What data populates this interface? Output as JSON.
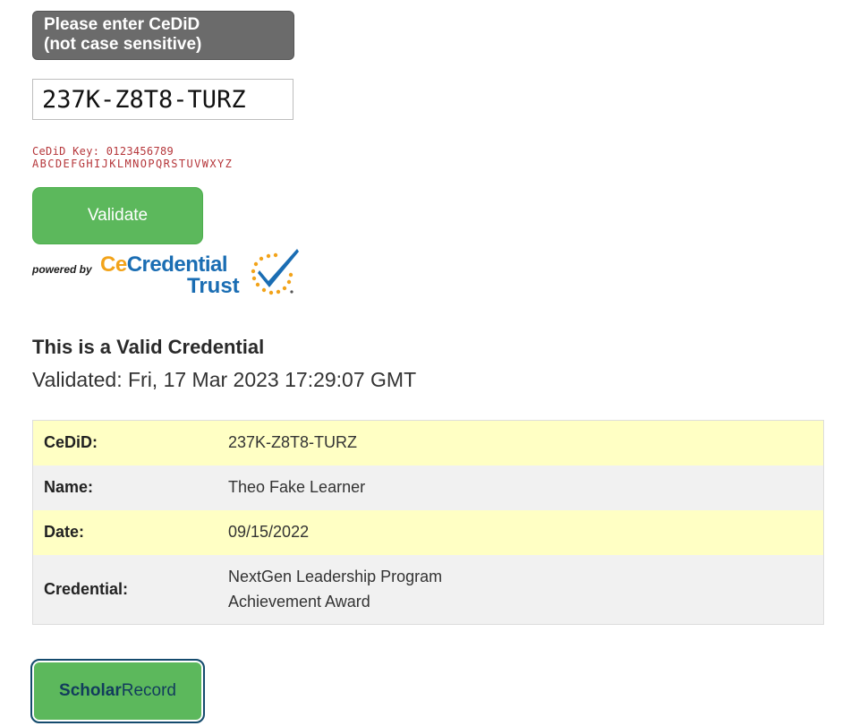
{
  "prompt": {
    "line1": "Please enter CeDiD",
    "line2": "(not case sensitive)"
  },
  "input": {
    "value": "237K-Z8T8-TURZ"
  },
  "key": {
    "line1": "CeDiD Key: 0123456789",
    "line2": "ABCDEFGHIJKLMNOPQRSTUVWXYZ"
  },
  "validate_label": "Validate",
  "branding": {
    "powered_by": "powered by",
    "brand_ce": "Ce",
    "brand_credential": "Credential",
    "brand_trust": "Trust"
  },
  "result": {
    "title": "This is a Valid Credential",
    "validated": "Validated: Fri, 17 Mar 2023 17:29:07 GMT"
  },
  "table": {
    "cedid_label": "CeDiD:",
    "cedid_value": "237K-Z8T8-TURZ",
    "name_label": "Name:",
    "name_value": "Theo Fake Learner",
    "date_label": "Date:",
    "date_value": "09/15/2022",
    "credential_label": "Credential:",
    "credential_line1": "NextGen Leadership Program",
    "credential_line2": "Achievement Award"
  },
  "scholar": {
    "bold": "Scholar",
    "rest": "Record"
  },
  "colors": {
    "button_green": "#5cb85c",
    "row_yellow": "#ffffc4",
    "row_gray": "#f1f1f1",
    "key_red": "#b5363a",
    "brand_blue": "#1a6db3",
    "brand_orange": "#f2a31a"
  }
}
